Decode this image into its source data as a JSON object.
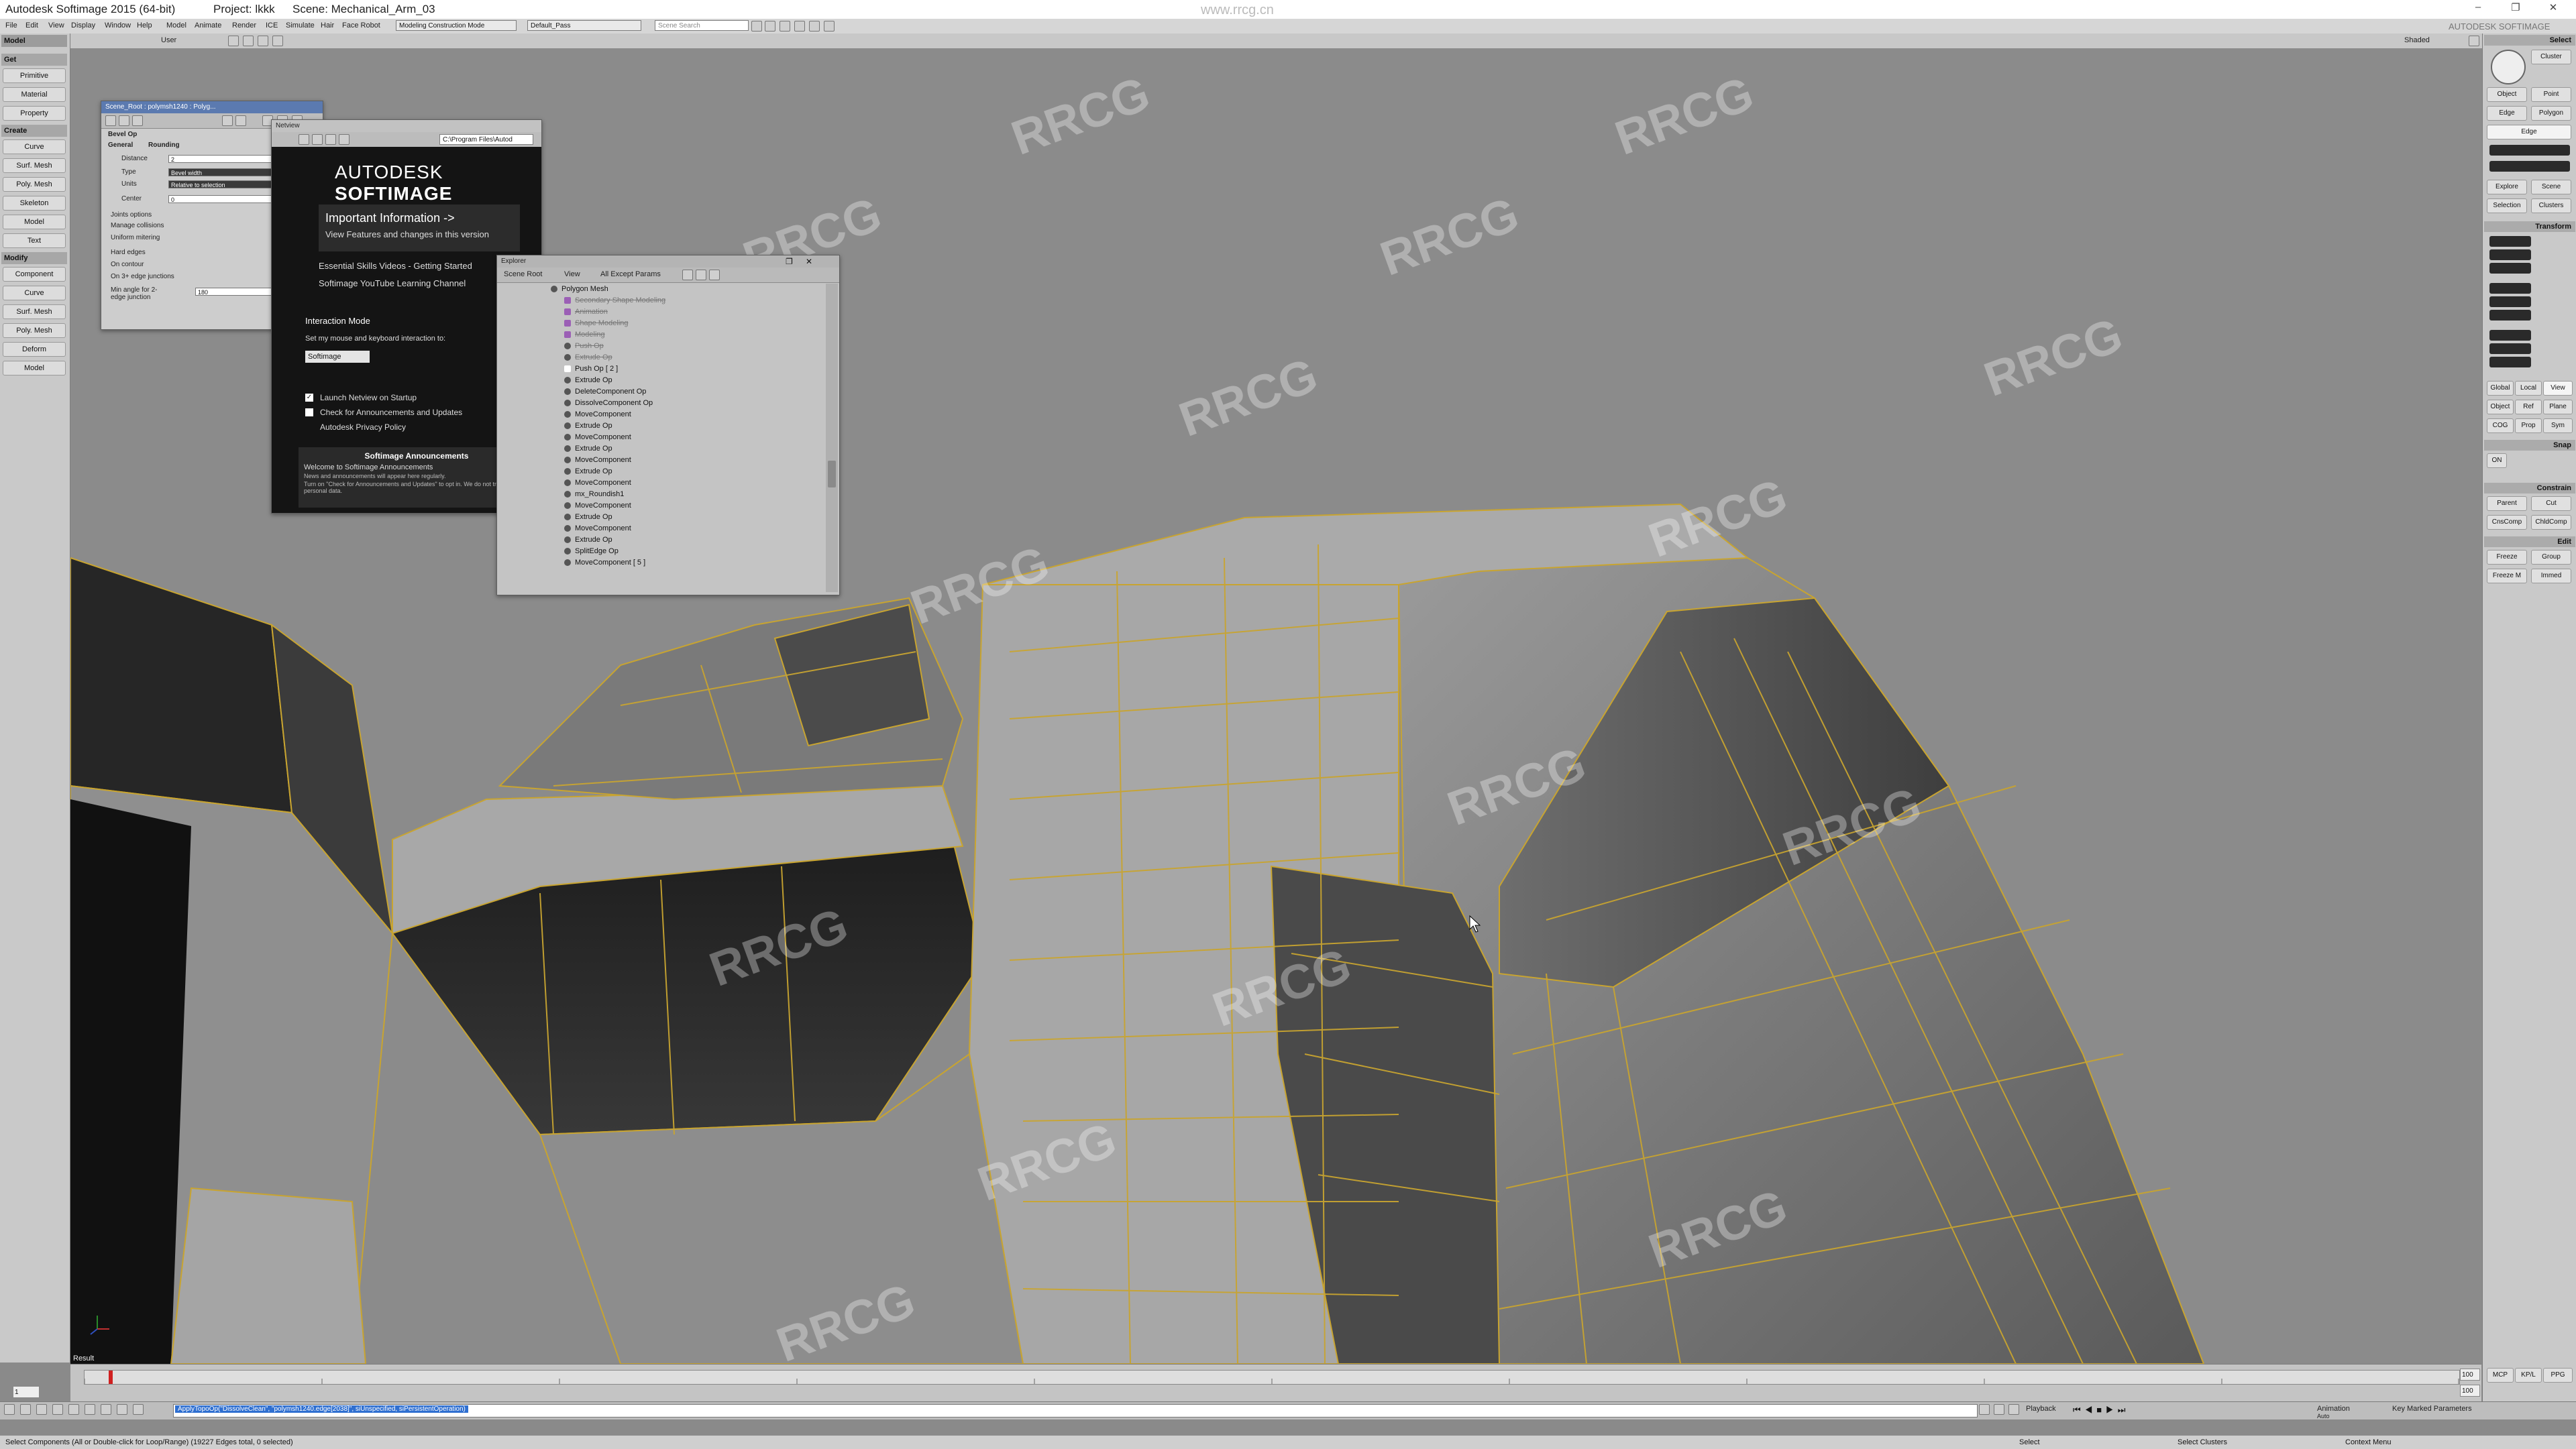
{
  "window": {
    "app_title": "Autodesk Softimage 2015 (64-bit)",
    "project": "Project: lkkk",
    "scene": "Scene: Mechanical_Arm_03",
    "watermark_url": "www.rrcg.cn",
    "brand_right": "AUTODESK SOFTIMAGE"
  },
  "menus": [
    "File",
    "Edit",
    "View",
    "Display",
    "Window",
    "Help",
    "Model",
    "Animate",
    "Render",
    "ICE",
    "Simulate",
    "Hair",
    "Face Robot"
  ],
  "toolbar": {
    "layout_combo": "Modeling Construction Mode",
    "pass_combo": "Default_Pass",
    "search_placeholder": "Scene Search",
    "user_label": "User",
    "shaded_label": "Shaded"
  },
  "left_toolbar": {
    "mode_label": "Model",
    "sections": [
      {
        "title": "Get",
        "buttons": [
          "Primitive",
          "Material",
          "Property"
        ]
      },
      {
        "title": "Create",
        "buttons": [
          "Curve",
          "Surf. Mesh",
          "Poly. Mesh",
          "Skeleton",
          "Model",
          "Text"
        ]
      },
      {
        "title": "Modify",
        "buttons": [
          "Component",
          "Curve",
          "Surf. Mesh",
          "Poly. Mesh",
          "Deform",
          "Model"
        ]
      }
    ]
  },
  "bevel_dialog": {
    "title": "Scene_Root : polymsh1240 : Polyg...",
    "header": "Bevel Op",
    "tabs": [
      "General",
      "Rounding"
    ],
    "distance_label": "Distance",
    "distance_value": "2",
    "type_label": "Type",
    "type_value": "Bevel width",
    "units_label": "Units",
    "units_value": "Relative to selection",
    "center_label": "Center",
    "center_value": "0",
    "joints_label": "Joints options",
    "manage_collisions": "Manage collisions",
    "uniform_mitering": "Uniform mitering",
    "hard_edges": "Hard edges",
    "on_contour": "On contour",
    "on_3plus": "On 3+ edge junctions",
    "min_angle_label": "Min angle for 2-edge junction",
    "min_angle_value": "180"
  },
  "netview": {
    "title": "Netview",
    "path": "C:\\Program Files\\Autod",
    "logo_a": "AUTODESK",
    "logo_b": "SOFTIMAGE",
    "important": "Important Information ->",
    "features": "View Features and changes in this version",
    "videos": "Essential Skills Videos - Getting Started",
    "youtube": "Softimage YouTube Learning Channel",
    "interaction_mode": "Interaction Mode",
    "interaction_desc": "Set my mouse and keyboard interaction to:",
    "interaction_value": "Softimage",
    "launch": "Launch Netview on Startup",
    "check_updates": "Check for Announcements and Updates",
    "privacy": "Autodesk Privacy Policy",
    "announcements_title": "Softimage Announcements",
    "announcements_welcome": "Welcome to Softimage Announcements",
    "announcements_body1": "News and announcements will appear here regularly.",
    "announcements_body2": "Turn on \"Check for Announcements and Updates\" to opt in. We do not track personal data."
  },
  "explorer": {
    "title": "Explorer",
    "scope": "Scene Root",
    "view": "View",
    "filter": "All Except Params",
    "items": [
      "Polygon Mesh",
      "Secondary Shape Modeling",
      "Animation",
      "Shape Modeling",
      "Modeling",
      "Push Op",
      "Extrude Op",
      "Push Op [ 2 ]",
      "Extrude Op",
      "DeleteComponent Op",
      "DissolveComponent Op",
      "MoveComponent",
      "Extrude Op",
      "MoveComponent",
      "Extrude Op",
      "MoveComponent",
      "Extrude Op",
      "MoveComponent",
      "mx_Roundish1",
      "MoveComponent",
      "Extrude Op",
      "MoveComponent",
      "Extrude Op",
      "SplitEdge Op",
      "MoveComponent [ 5 ]"
    ]
  },
  "right_panel": {
    "select": "Select",
    "cluster": "Cluster",
    "object": "Object",
    "point": "Point",
    "edge": "Edge",
    "polygon": "Polygon",
    "edge_mode": "Edge",
    "explore": "Explore",
    "scene": "Scene",
    "selection": "Selection",
    "clusters": "Clusters",
    "transform": "Transform",
    "global": "Global",
    "local": "Local",
    "view": "View",
    "object2": "Object",
    "ref": "Ref",
    "plane": "Plane",
    "cog": "COG",
    "prop": "Prop",
    "sym": "Sym",
    "snap": "Snap",
    "on": "ON",
    "constrain": "Constrain",
    "parent": "Parent",
    "cut": "Cut",
    "cnscomp": "CnsComp",
    "chldcomp": "ChldComp",
    "edit": "Edit",
    "freeze": "Freeze",
    "group": "Group",
    "freeze_m": "Freeze M",
    "immed": "Immed",
    "mcp": "MCP",
    "kp_l": "KP/L",
    "ppg": "PPG"
  },
  "viewport": {
    "result_label": "Result"
  },
  "timeline": {
    "start": "1",
    "end": "100",
    "end2": "100",
    "playback": "Playback",
    "animation": "Animation",
    "auto": "Auto",
    "key_marked": "Key Marked Parameters"
  },
  "command": {
    "text": "ApplyTopoOp(\"DissolveClean\", \"polymsh1240.edge[2038]\", siUnspecified, siPersistentOperation)"
  },
  "status": {
    "left": "Select Components (All or Double-click for Loop/Range) (19227 Edges total, 0 selected)",
    "mid1": "Select",
    "mid2": "Select Clusters",
    "right": "Context Menu"
  }
}
